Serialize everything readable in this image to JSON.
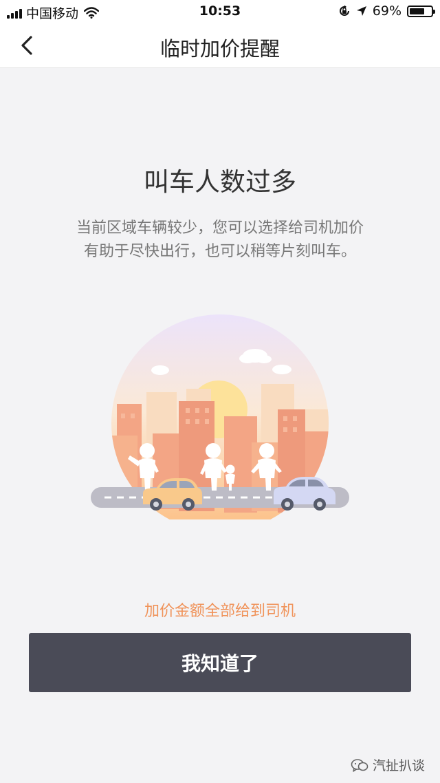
{
  "status_bar": {
    "carrier": "中国移动",
    "time": "10:53",
    "battery_percent": "69%",
    "battery_level": 0.69,
    "icons": [
      "signal-icon",
      "wifi-icon",
      "rotation-lock-icon",
      "location-icon",
      "battery-icon"
    ]
  },
  "nav": {
    "title": "临时加价提醒",
    "back_icon": "chevron-left-icon"
  },
  "main": {
    "heading": "叫车人数过多",
    "description_line1": "当前区域车辆较少，您可以选择给司机加价",
    "description_line2": "有助于尽快出行，也可以稍等片刻叫车。",
    "illustration": "city-street-people-cars-illustration"
  },
  "footer": {
    "hint": "加价金额全部给到司机",
    "confirm_label": "我知道了"
  },
  "watermark": {
    "text": "汽扯扒谈",
    "icon": "wechat-icon"
  },
  "colors": {
    "accent_orange": "#f0935a",
    "button_dark": "#4a4b57",
    "background": "#f3f3f5"
  }
}
